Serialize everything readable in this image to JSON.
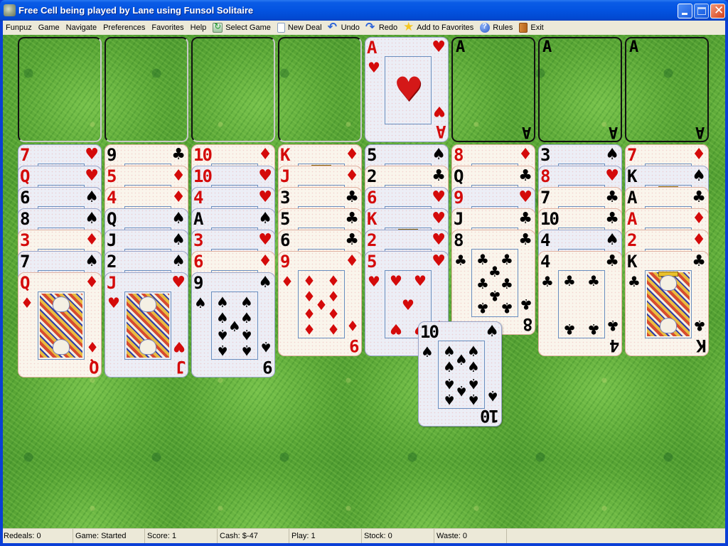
{
  "window": {
    "title": "Free Cell being played by Lane using Funsol Solitaire",
    "controls": [
      "minimize",
      "maximize",
      "close"
    ]
  },
  "menubar": {
    "items": [
      {
        "label": "Funpuz",
        "icon": null
      },
      {
        "label": "Game",
        "icon": null
      },
      {
        "label": "Navigate",
        "icon": null
      },
      {
        "label": "Preferences",
        "icon": null
      },
      {
        "label": "Favorites",
        "icon": null
      },
      {
        "label": "Help",
        "icon": null
      },
      {
        "label": "Select Game",
        "icon": "refresh-icon"
      },
      {
        "label": "New Deal",
        "icon": "page-icon"
      },
      {
        "label": "Undo",
        "icon": "undo-arrow-icon"
      },
      {
        "label": "Redo",
        "icon": "redo-arrow-icon"
      },
      {
        "label": "Add to Favorites",
        "icon": "star-icon"
      },
      {
        "label": "Rules",
        "icon": "help-circle-icon"
      },
      {
        "label": "Exit",
        "icon": "door-icon"
      }
    ]
  },
  "board": {
    "free_cells": [
      null,
      null,
      null,
      null
    ],
    "foundations": [
      {
        "top_card": {
          "rank": "A",
          "suit": "hearts"
        }
      },
      {
        "top_card": null,
        "placeholder": "A"
      },
      {
        "top_card": null,
        "placeholder": "A"
      },
      {
        "top_card": null,
        "placeholder": "A"
      }
    ],
    "tableau": [
      [
        {
          "rank": "7",
          "suit": "hearts"
        },
        {
          "rank": "Q",
          "suit": "hearts"
        },
        {
          "rank": "6",
          "suit": "spades"
        },
        {
          "rank": "8",
          "suit": "spades"
        },
        {
          "rank": "3",
          "suit": "diamonds"
        },
        {
          "rank": "7",
          "suit": "spades"
        },
        {
          "rank": "Q",
          "suit": "diamonds"
        }
      ],
      [
        {
          "rank": "9",
          "suit": "clubs"
        },
        {
          "rank": "5",
          "suit": "diamonds"
        },
        {
          "rank": "4",
          "suit": "diamonds"
        },
        {
          "rank": "Q",
          "suit": "spades"
        },
        {
          "rank": "J",
          "suit": "spades"
        },
        {
          "rank": "2",
          "suit": "spades"
        },
        {
          "rank": "J",
          "suit": "hearts"
        }
      ],
      [
        {
          "rank": "10",
          "suit": "diamonds"
        },
        {
          "rank": "10",
          "suit": "hearts"
        },
        {
          "rank": "4",
          "suit": "hearts"
        },
        {
          "rank": "A",
          "suit": "spades"
        },
        {
          "rank": "3",
          "suit": "hearts"
        },
        {
          "rank": "6",
          "suit": "diamonds"
        },
        {
          "rank": "9",
          "suit": "spades"
        }
      ],
      [
        {
          "rank": "K",
          "suit": "diamonds"
        },
        {
          "rank": "J",
          "suit": "diamonds"
        },
        {
          "rank": "3",
          "suit": "clubs"
        },
        {
          "rank": "5",
          "suit": "clubs"
        },
        {
          "rank": "6",
          "suit": "clubs"
        },
        {
          "rank": "9",
          "suit": "diamonds"
        }
      ],
      [
        {
          "rank": "5",
          "suit": "spades"
        },
        {
          "rank": "2",
          "suit": "clubs"
        },
        {
          "rank": "6",
          "suit": "hearts"
        },
        {
          "rank": "K",
          "suit": "hearts"
        },
        {
          "rank": "2",
          "suit": "hearts"
        },
        {
          "rank": "5",
          "suit": "hearts"
        }
      ],
      [
        {
          "rank": "8",
          "suit": "diamonds"
        },
        {
          "rank": "Q",
          "suit": "clubs"
        },
        {
          "rank": "9",
          "suit": "hearts"
        },
        {
          "rank": "J",
          "suit": "clubs"
        },
        {
          "rank": "8",
          "suit": "clubs"
        }
      ],
      [
        {
          "rank": "3",
          "suit": "spades"
        },
        {
          "rank": "8",
          "suit": "hearts"
        },
        {
          "rank": "7",
          "suit": "clubs"
        },
        {
          "rank": "10",
          "suit": "clubs"
        },
        {
          "rank": "4",
          "suit": "spades"
        },
        {
          "rank": "4",
          "suit": "clubs"
        }
      ],
      [
        {
          "rank": "7",
          "suit": "diamonds"
        },
        {
          "rank": "K",
          "suit": "spades"
        },
        {
          "rank": "A",
          "suit": "clubs"
        },
        {
          "rank": "A",
          "suit": "diamonds"
        },
        {
          "rank": "2",
          "suit": "diamonds"
        },
        {
          "rank": "K",
          "suit": "clubs"
        }
      ]
    ],
    "dragging_card": {
      "rank": "10",
      "suit": "spades"
    }
  },
  "statusbar": {
    "redeals": "Redeals: 0",
    "game": "Game: Started",
    "score": "Score: 1",
    "cash": "Cash:  $-47",
    "play": "Play: 1",
    "stock": "Stock: 0",
    "waste": "Waste: 0"
  },
  "colors": {
    "titlebar": "#0353e0",
    "menubar": "#ece9d8",
    "felt": "#5fae3a",
    "red_suit": "#d40a0a",
    "black_suit": "#000000"
  }
}
